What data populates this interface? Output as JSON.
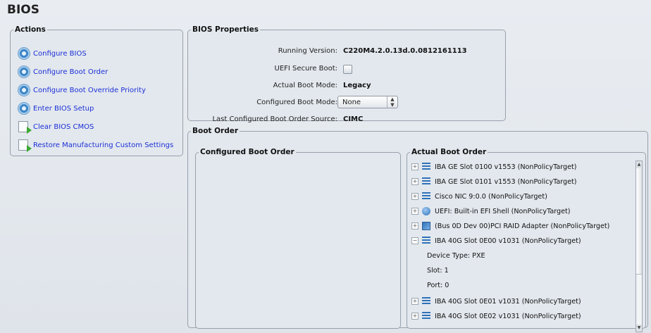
{
  "page": {
    "title": "BIOS"
  },
  "actions": {
    "legend": "Actions",
    "items": [
      {
        "label": "Configure BIOS",
        "icon": "gear-icon"
      },
      {
        "label": "Configure Boot Order",
        "icon": "gear-icon"
      },
      {
        "label": "Configure Boot Override Priority",
        "icon": "gear-icon"
      },
      {
        "label": "Enter BIOS Setup",
        "icon": "gear-icon"
      },
      {
        "label": "Clear BIOS CMOS",
        "icon": "document-arrow-icon"
      },
      {
        "label": "Restore Manufacturing Custom Settings",
        "icon": "document-arrow-icon"
      }
    ]
  },
  "bios_properties": {
    "legend": "BIOS Properties",
    "running_version_label": "Running Version:",
    "running_version": "C220M4.2.0.13d.0.0812161113",
    "uefi_secure_boot_label": "UEFI Secure Boot:",
    "uefi_secure_boot_checked": false,
    "actual_boot_mode_label": "Actual Boot Mode:",
    "actual_boot_mode": "Legacy",
    "configured_boot_mode_label": "Configured Boot Mode:",
    "configured_boot_mode": "None",
    "last_configured_source_label": "Last Configured Boot Order Source:",
    "last_configured_source": "CIMC"
  },
  "boot_order": {
    "legend": "Boot Order",
    "configured_legend": "Configured Boot Order",
    "actual_legend": "Actual Boot Order",
    "actual_items": [
      {
        "label": "IBA GE Slot 0100 v1553 (NonPolicyTarget)",
        "expander": "+",
        "icon": "network-icon"
      },
      {
        "label": "IBA GE Slot 0101 v1553 (NonPolicyTarget)",
        "expander": "+",
        "icon": "network-icon"
      },
      {
        "label": "Cisco NIC 9:0.0 (NonPolicyTarget)",
        "expander": "+",
        "icon": "network-icon"
      },
      {
        "label": "UEFI: Built-in EFI Shell  (NonPolicyTarget)",
        "expander": "+",
        "icon": "efi-shell-icon"
      },
      {
        "label": "(Bus 0D Dev 00)PCI RAID Adapter (NonPolicyTarget)",
        "expander": "+",
        "icon": "raid-adapter-icon"
      },
      {
        "label": "IBA 40G Slot 0E00 v1031 (NonPolicyTarget)",
        "expander": "−",
        "icon": "network-icon"
      },
      {
        "label": "IBA 40G Slot 0E01 v1031 (NonPolicyTarget)",
        "expander": "+",
        "icon": "network-icon"
      },
      {
        "label": "IBA 40G Slot 0E02 v1031 (NonPolicyTarget)",
        "expander": "+",
        "icon": "network-icon"
      }
    ],
    "expanded_details": {
      "device_type": "Device Type: PXE",
      "slot": "Slot: 1",
      "port": "Port: 0"
    }
  },
  "colors": {
    "link": "#1b2fd6",
    "panel": "#e3e8ee",
    "border": "#98a0aa",
    "icon_blue": "#2f72b9"
  }
}
